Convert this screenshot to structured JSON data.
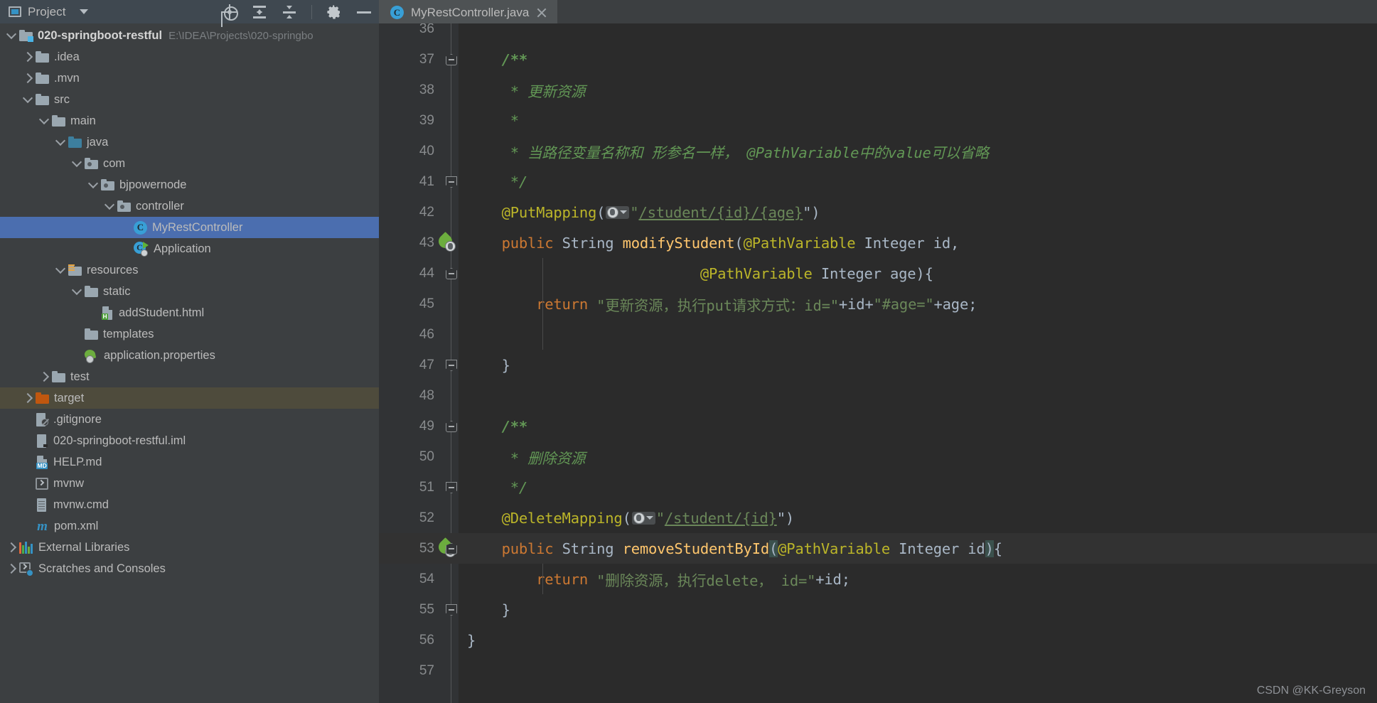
{
  "window": {
    "tool_window_title": "Project",
    "tool_window_icon": "project-window-icon",
    "toolbar_icons": [
      "locate-icon",
      "expand-all-icon",
      "collapse-all-icon",
      "gear-icon",
      "minimize-icon"
    ]
  },
  "editor_tabs": [
    {
      "label": "MyRestController.java",
      "icon": "java-class-icon",
      "close_icon": "close-icon",
      "active": true
    }
  ],
  "project_tree": [
    {
      "id": "root",
      "label": "020-springboot-restful",
      "secondary": "E:\\IDEA\\Projects\\020-springbo",
      "indent": 0,
      "arrow": "down",
      "icon": "module-folder-icon",
      "bold": true
    },
    {
      "id": "idea",
      "label": ".idea",
      "indent": 1,
      "arrow": "right",
      "icon": "folder-icon"
    },
    {
      "id": "mvn",
      "label": ".mvn",
      "indent": 1,
      "arrow": "right",
      "icon": "folder-icon"
    },
    {
      "id": "src",
      "label": "src",
      "indent": 1,
      "arrow": "down",
      "icon": "folder-icon"
    },
    {
      "id": "main",
      "label": "main",
      "indent": 2,
      "arrow": "down",
      "icon": "folder-icon"
    },
    {
      "id": "java",
      "label": "java",
      "indent": 3,
      "arrow": "down",
      "icon": "source-folder-icon"
    },
    {
      "id": "com",
      "label": "com",
      "indent": 4,
      "arrow": "down",
      "icon": "package-icon"
    },
    {
      "id": "bjpowernode",
      "label": "bjpowernode",
      "indent": 5,
      "arrow": "down",
      "icon": "package-icon"
    },
    {
      "id": "controller",
      "label": "controller",
      "indent": 6,
      "arrow": "down",
      "icon": "package-icon"
    },
    {
      "id": "myrestcontroller",
      "label": "MyRestController",
      "indent": 7,
      "arrow": "none",
      "icon": "java-class-icon",
      "selected": true
    },
    {
      "id": "application",
      "label": "Application",
      "indent": 7,
      "arrow": "none",
      "icon": "spring-application-icon"
    },
    {
      "id": "resources",
      "label": "resources",
      "indent": 3,
      "arrow": "down",
      "icon": "resources-folder-icon"
    },
    {
      "id": "static",
      "label": "static",
      "indent": 4,
      "arrow": "down",
      "icon": "folder-icon"
    },
    {
      "id": "addstudent",
      "label": "addStudent.html",
      "indent": 5,
      "arrow": "none",
      "icon": "html-file-icon"
    },
    {
      "id": "templates",
      "label": "templates",
      "indent": 4,
      "arrow": "none",
      "icon": "folder-icon"
    },
    {
      "id": "appprops",
      "label": "application.properties",
      "indent": 4,
      "arrow": "none",
      "icon": "spring-properties-icon"
    },
    {
      "id": "test",
      "label": "test",
      "indent": 2,
      "arrow": "right",
      "icon": "folder-icon"
    },
    {
      "id": "target",
      "label": "target",
      "indent": 1,
      "arrow": "right",
      "icon": "target-folder-icon",
      "highlighted": true
    },
    {
      "id": "gitignore",
      "label": ".gitignore",
      "indent": 1,
      "arrow": "none",
      "icon": "gitignore-file-icon"
    },
    {
      "id": "iml",
      "label": "020-springboot-restful.iml",
      "indent": 1,
      "arrow": "none",
      "icon": "iml-file-icon"
    },
    {
      "id": "help",
      "label": "HELP.md",
      "indent": 1,
      "arrow": "none",
      "icon": "markdown-file-icon"
    },
    {
      "id": "mvnw",
      "label": "mvnw",
      "indent": 1,
      "arrow": "none",
      "icon": "shell-script-icon"
    },
    {
      "id": "mvnwcmd",
      "label": "mvnw.cmd",
      "indent": 1,
      "arrow": "none",
      "icon": "cmd-file-icon"
    },
    {
      "id": "pom",
      "label": "pom.xml",
      "indent": 1,
      "arrow": "none",
      "icon": "maven-file-icon"
    },
    {
      "id": "extlibs",
      "label": "External Libraries",
      "indent": 0,
      "arrow": "right",
      "icon": "libraries-icon"
    },
    {
      "id": "scratches",
      "label": "Scratches and Consoles",
      "indent": 0,
      "arrow": "right",
      "icon": "scratches-icon"
    }
  ],
  "code_lines": [
    {
      "num": "36",
      "fold": "none",
      "gutter": "none",
      "indents": [],
      "tokens": []
    },
    {
      "num": "37",
      "fold": "top",
      "gutter": "none",
      "indents": [],
      "tokens": [
        {
          "t": "    /**",
          "c": "cmtb"
        }
      ]
    },
    {
      "num": "38",
      "fold": "none",
      "gutter": "none",
      "indents": [],
      "tokens": [
        {
          "t": "     * 更新资源",
          "c": "cmt"
        }
      ]
    },
    {
      "num": "39",
      "fold": "none",
      "gutter": "none",
      "indents": [],
      "tokens": [
        {
          "t": "     *",
          "c": "cmt"
        }
      ]
    },
    {
      "num": "40",
      "fold": "none",
      "gutter": "none",
      "indents": [],
      "tokens": [
        {
          "t": "     * 当路径变量名称和 形参名一样， @PathVariable中的value可以省略",
          "c": "cmt"
        }
      ]
    },
    {
      "num": "41",
      "fold": "bot",
      "gutter": "none",
      "indents": [],
      "tokens": [
        {
          "t": "     */",
          "c": "cmt"
        }
      ]
    },
    {
      "num": "42",
      "fold": "none",
      "gutter": "none",
      "indents": [],
      "tokens": [
        {
          "t": "    @PutMapping",
          "c": "anno"
        },
        {
          "t": "(",
          "c": "pun"
        },
        {
          "t": "globe-gutter-icon",
          "c": "globe"
        },
        {
          "t": "\"",
          "c": "str"
        },
        {
          "t": "/student/{id}/{age}",
          "c": "urlstr"
        },
        {
          "t": "\")",
          "c": "pun"
        }
      ]
    },
    {
      "num": "43",
      "fold": "none",
      "gutter": "spring-mapping-icon",
      "indents": [],
      "tokens": [
        {
          "t": "    public ",
          "c": "kw"
        },
        {
          "t": "String ",
          "c": "typ"
        },
        {
          "t": "modifyStudent",
          "c": "mth"
        },
        {
          "t": "(",
          "c": "pun"
        },
        {
          "t": "@PathVariable ",
          "c": "anno"
        },
        {
          "t": "Integer ",
          "c": "typ"
        },
        {
          "t": "id,",
          "c": "ident"
        }
      ]
    },
    {
      "num": "44",
      "fold": "top",
      "gutter": "none",
      "indents": [
        118
      ],
      "tokens": [
        {
          "t": "                           ",
          "c": "pun"
        },
        {
          "t": "@PathVariable ",
          "c": "anno"
        },
        {
          "t": "Integer ",
          "c": "typ"
        },
        {
          "t": "age",
          "c": "ident"
        },
        {
          "t": "){",
          "c": "pun"
        }
      ]
    },
    {
      "num": "45",
      "fold": "none",
      "gutter": "none",
      "indents": [
        118
      ],
      "tokens": [
        {
          "t": "        return ",
          "c": "kw"
        },
        {
          "t": "\"更新资源，执行put请求方式：id=\"",
          "c": "str"
        },
        {
          "t": "+",
          "c": "pun"
        },
        {
          "t": "id",
          "c": "ident"
        },
        {
          "t": "+",
          "c": "pun"
        },
        {
          "t": "\"#age=\"",
          "c": "str"
        },
        {
          "t": "+",
          "c": "pun"
        },
        {
          "t": "age;",
          "c": "ident"
        }
      ]
    },
    {
      "num": "46",
      "fold": "none",
      "gutter": "none",
      "indents": [
        118
      ],
      "tokens": []
    },
    {
      "num": "47",
      "fold": "bot",
      "gutter": "none",
      "indents": [],
      "tokens": [
        {
          "t": "    }",
          "c": "pun"
        }
      ]
    },
    {
      "num": "48",
      "fold": "none",
      "gutter": "none",
      "indents": [],
      "tokens": []
    },
    {
      "num": "49",
      "fold": "top",
      "gutter": "none",
      "indents": [],
      "tokens": [
        {
          "t": "    /**",
          "c": "cmtb"
        }
      ]
    },
    {
      "num": "50",
      "fold": "none",
      "gutter": "none",
      "indents": [],
      "tokens": [
        {
          "t": "     * 删除资源",
          "c": "cmt"
        }
      ]
    },
    {
      "num": "51",
      "fold": "bot",
      "gutter": "none",
      "indents": [],
      "tokens": [
        {
          "t": "     */",
          "c": "cmt"
        }
      ]
    },
    {
      "num": "52",
      "fold": "none",
      "gutter": "none",
      "indents": [],
      "tokens": [
        {
          "t": "    @DeleteMapping",
          "c": "anno"
        },
        {
          "t": "(",
          "c": "pun"
        },
        {
          "t": "globe-gutter-icon",
          "c": "globe"
        },
        {
          "t": "\"",
          "c": "str"
        },
        {
          "t": "/student/{id}",
          "c": "urlstr"
        },
        {
          "t": "\")",
          "c": "pun"
        }
      ]
    },
    {
      "num": "53",
      "fold": "top",
      "gutter": "spring-mapping-icon",
      "current": true,
      "indents": [],
      "tokens": [
        {
          "t": "    public ",
          "c": "kw"
        },
        {
          "t": "String ",
          "c": "typ"
        },
        {
          "t": "removeStudentById",
          "c": "mth"
        },
        {
          "t": "(",
          "c": "pun brk-hl"
        },
        {
          "t": "@PathVariable ",
          "c": "anno"
        },
        {
          "t": "Integer ",
          "c": "typ"
        },
        {
          "t": "id",
          "c": "ident"
        },
        {
          "t": ")",
          "c": "pun brk-hl"
        },
        {
          "t": "{",
          "c": "pun"
        }
      ]
    },
    {
      "num": "54",
      "fold": "none",
      "gutter": "none",
      "indents": [
        118
      ],
      "tokens": [
        {
          "t": "        return ",
          "c": "kw"
        },
        {
          "t": "\"删除资源，执行delete， id=\"",
          "c": "str"
        },
        {
          "t": "+",
          "c": "pun"
        },
        {
          "t": "id;",
          "c": "ident"
        }
      ]
    },
    {
      "num": "55",
      "fold": "bot",
      "gutter": "none",
      "indents": [],
      "tokens": [
        {
          "t": "    }",
          "c": "pun"
        }
      ]
    },
    {
      "num": "56",
      "fold": "none",
      "gutter": "none",
      "indents": [],
      "tokens": [
        {
          "t": "}",
          "c": "pun"
        }
      ]
    },
    {
      "num": "57",
      "fold": "none",
      "gutter": "none",
      "indents": [],
      "tokens": []
    }
  ],
  "watermark": "CSDN @KK-Greyson",
  "colors": {
    "editor_bg": "#2b2b2b",
    "gutter_bg": "#313335",
    "panel_bg": "#3c3f41",
    "toolbar_bg": "#3f4850",
    "selection_blue": "#4b6eaf",
    "highlight_olive": "#4e4b3c",
    "comment_green": "#629755",
    "string_green": "#6a8759",
    "keyword_orange": "#cc7832",
    "annotation_yellow": "#bbb529",
    "method_gold": "#ffc66d",
    "identifier_grey": "#a9b7c6",
    "current_line": "#323232"
  }
}
